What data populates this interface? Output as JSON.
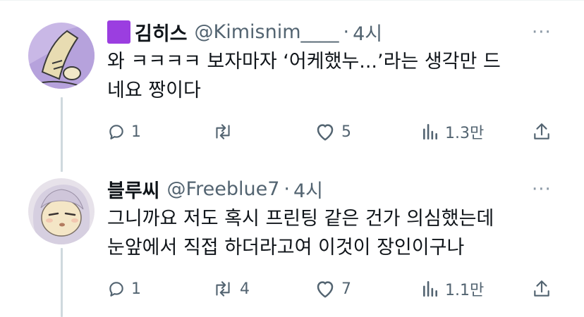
{
  "replies": [
    {
      "name": "김히스",
      "handle": "@Kimisnim____",
      "separator": "·",
      "time": "4시",
      "more": "···",
      "text_lines": [
        "와 ㅋㅋㅋㅋ 보자마자 ‘어케했누...’라는 생각만 드",
        "네요 짱이다"
      ],
      "reply_count": "1",
      "retweet_count": "",
      "like_count": "5",
      "view_count": "1.3만",
      "badge_color": "#9b3ee0"
    },
    {
      "name": "블루씨",
      "handle": "@Freeblue7",
      "separator": "·",
      "time": "4시",
      "more": "···",
      "text_lines": [
        "그니까요 저도 혹시 프린팅 같은 건가 의심했는데",
        "눈앞에서 직접 하더라고여 이것이 장인이구나"
      ],
      "reply_count": "1",
      "retweet_count": "4",
      "like_count": "7",
      "view_count": "1.1만"
    }
  ],
  "icons": {
    "reply": "reply-icon",
    "retweet": "retweet-icon",
    "like": "heart-icon",
    "views": "views-icon",
    "share": "share-icon",
    "more": "more-icon"
  }
}
